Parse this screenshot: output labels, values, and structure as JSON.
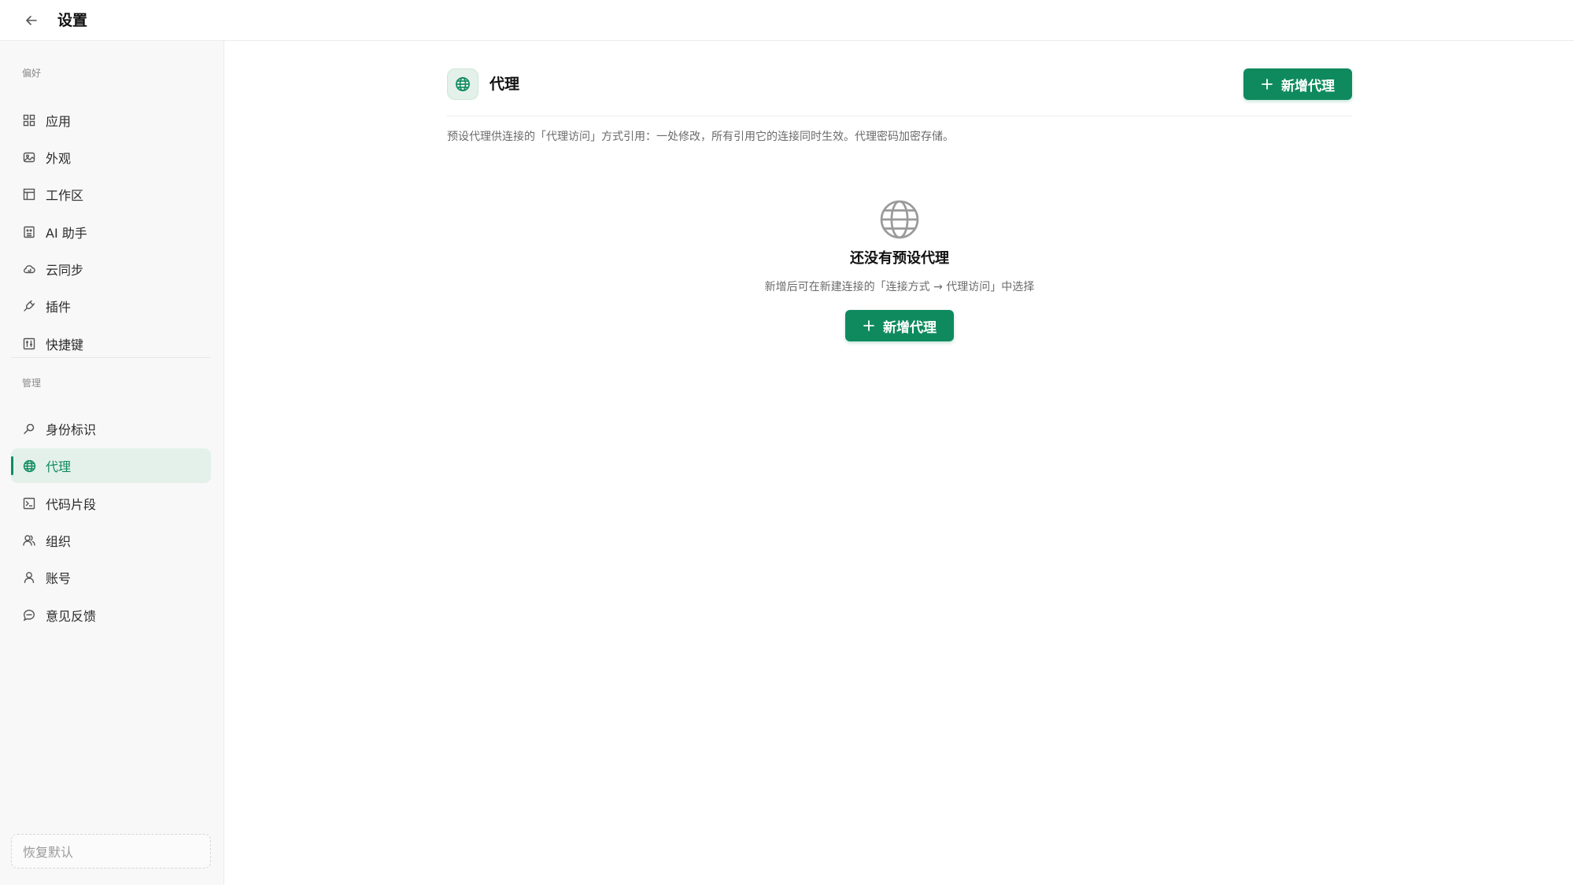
{
  "window": {
    "title": "设置",
    "back_icon": "arrow-left-icon"
  },
  "sidebar": {
    "preferences_label": "偏好",
    "preferences_items": [
      {
        "label": "应用",
        "icon": "grid-icon"
      },
      {
        "label": "外观",
        "icon": "image-icon"
      },
      {
        "label": "工作区",
        "icon": "layout-icon"
      },
      {
        "label": "AI 助手",
        "icon": "bot-icon"
      },
      {
        "label": "云同步",
        "icon": "cloud-sync-icon"
      },
      {
        "label": "插件",
        "icon": "plug-icon"
      },
      {
        "label": "快捷键",
        "icon": "keyboard-icon"
      }
    ],
    "management_label": "管理",
    "management_items": [
      {
        "label": "身份标识",
        "icon": "key-icon"
      },
      {
        "label": "代理",
        "icon": "globe-icon",
        "active": true
      },
      {
        "label": "代码片段",
        "icon": "terminal-icon"
      },
      {
        "label": "组织",
        "icon": "users-icon"
      },
      {
        "label": "账号",
        "icon": "user-icon"
      },
      {
        "label": "意见反馈",
        "icon": "message-icon"
      }
    ],
    "restore_label": "恢复默认"
  },
  "main": {
    "section_title": "代理",
    "section_icon": "globe-icon",
    "add_button_label": "新增代理",
    "description": "预设代理供连接的「代理访问」方式引用：一处修改，所有引用它的连接同时生效。代理密码加密存储。",
    "empty_state": {
      "icon": "globe-icon",
      "title": "还没有预设代理",
      "subtitle": "新增后可在新建连接的「连接方式 → 代理访问」中选择",
      "button_label": "新增代理"
    }
  },
  "colors": {
    "accent": "#0f8a5f",
    "active_bg": "#e3f1ea",
    "sidebar_bg": "#f8f8f8"
  }
}
